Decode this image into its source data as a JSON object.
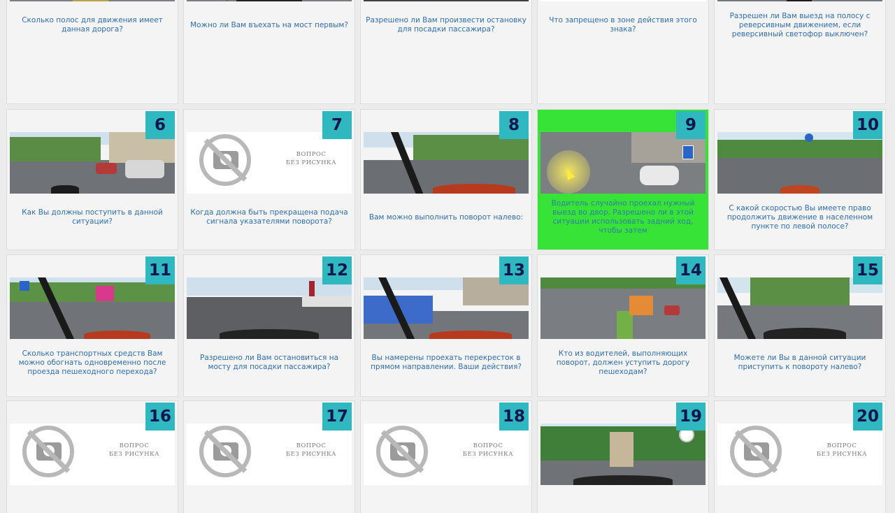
{
  "page": {
    "background": "#ececec",
    "accent_number_bg": "#2fb8c0",
    "question_color": "#2f6db7",
    "highlight_color": "#37e337"
  },
  "cards": [
    {
      "num": "",
      "question": "Сколько полос для движения имеет данная дорога?",
      "image": "road-median"
    },
    {
      "num": "",
      "question": "Можно ли Вам въехать на мост первым?",
      "image": "bridge-view"
    },
    {
      "num": "",
      "question": "Разрешено ли Вам произвести остановку для посадки пассажира?",
      "image": "city-street"
    },
    {
      "num": "",
      "question": "Что запрещено в зоне действия этого знака?",
      "image": "pedestrian-sign"
    },
    {
      "num": "",
      "question": "Разрешен ли Вам выезд на полосу с реверсивным движением, если реверсивный светофор выключен?",
      "image": "highway-bus"
    },
    {
      "num": "6",
      "question": "Как Вы должны поступить в данной ситуации?",
      "image": "police-street"
    },
    {
      "num": "7",
      "question": "Когда должна быть прекращена подача сигнала указателями поворота?",
      "image": "no-photo",
      "placeholder": "ВОПРОС\nБЕЗ РИСУНКА"
    },
    {
      "num": "8",
      "question": "Вам можно выполнить поворот налево:",
      "image": "turn-left"
    },
    {
      "num": "9",
      "question": "Водитель случайно проехал нужный выезд во двор. Разрешено ли в этой ситуации использовать задний ход, чтобы затем",
      "image": "reverse-yard",
      "active": true
    },
    {
      "num": "10",
      "question": "С какой скоростью Вы имеете право продолжить движение в населенном пункте по левой полосе?",
      "image": "speed-road"
    },
    {
      "num": "11",
      "question": "Сколько транспортных средств Вам можно обогнать одновременно после проезда пешеходного перехода?",
      "image": "crosswalk"
    },
    {
      "num": "12",
      "question": "Разрешено ли Вам остановиться на мосту для посадки пассажира?",
      "image": "bridge-stop"
    },
    {
      "num": "13",
      "question": "Вы намерены проехать перекресток в прямом направлении. Ваши действия?",
      "image": "tram-cross"
    },
    {
      "num": "14",
      "question": "Кто из водителей, выполняющих поворот, должен уступить дорогу пешеходам?",
      "image": "top-view"
    },
    {
      "num": "15",
      "question": "Можете ли Вы в данной ситуации приступить к повороту налево?",
      "image": "left-turn"
    },
    {
      "num": "16",
      "question": "",
      "image": "no-photo",
      "placeholder": "ВОПРОС\nБЕЗ РИСУНКА"
    },
    {
      "num": "17",
      "question": "",
      "image": "no-photo",
      "placeholder": "ВОПРОС\nБЕЗ РИСУНКА"
    },
    {
      "num": "18",
      "question": "",
      "image": "no-photo",
      "placeholder": "ВОПРОС\nБЕЗ РИСУНКА"
    },
    {
      "num": "19",
      "question": "",
      "image": "truck-road"
    },
    {
      "num": "20",
      "question": "",
      "image": "no-photo",
      "placeholder": "ВОПРОС\nБЕЗ РИСУНКА"
    }
  ]
}
